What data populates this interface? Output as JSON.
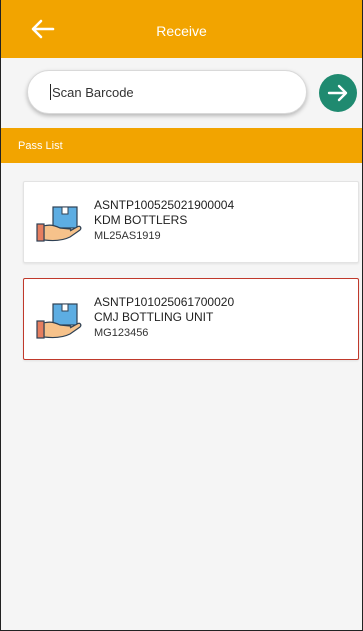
{
  "app_bar": {
    "title": "Receive",
    "back_icon": "arrow-left-icon",
    "color": "#f2a400"
  },
  "search": {
    "placeholder": "Scan Barcode",
    "value": "",
    "submit_icon": "arrow-right-icon",
    "submit_color": "#1f8a70"
  },
  "pass_list": {
    "title": "Pass List",
    "items": [
      {
        "asn": "ASNTP100525021900004",
        "name": "KDM BOTTLERS",
        "code": "ML25AS1919",
        "icon": "package-in-hand-icon",
        "selected": false
      },
      {
        "asn": "ASNTP101025061700020",
        "name": "CMJ BOTTLING UNIT",
        "code": "MG123456",
        "icon": "package-in-hand-icon",
        "selected": true
      }
    ]
  }
}
